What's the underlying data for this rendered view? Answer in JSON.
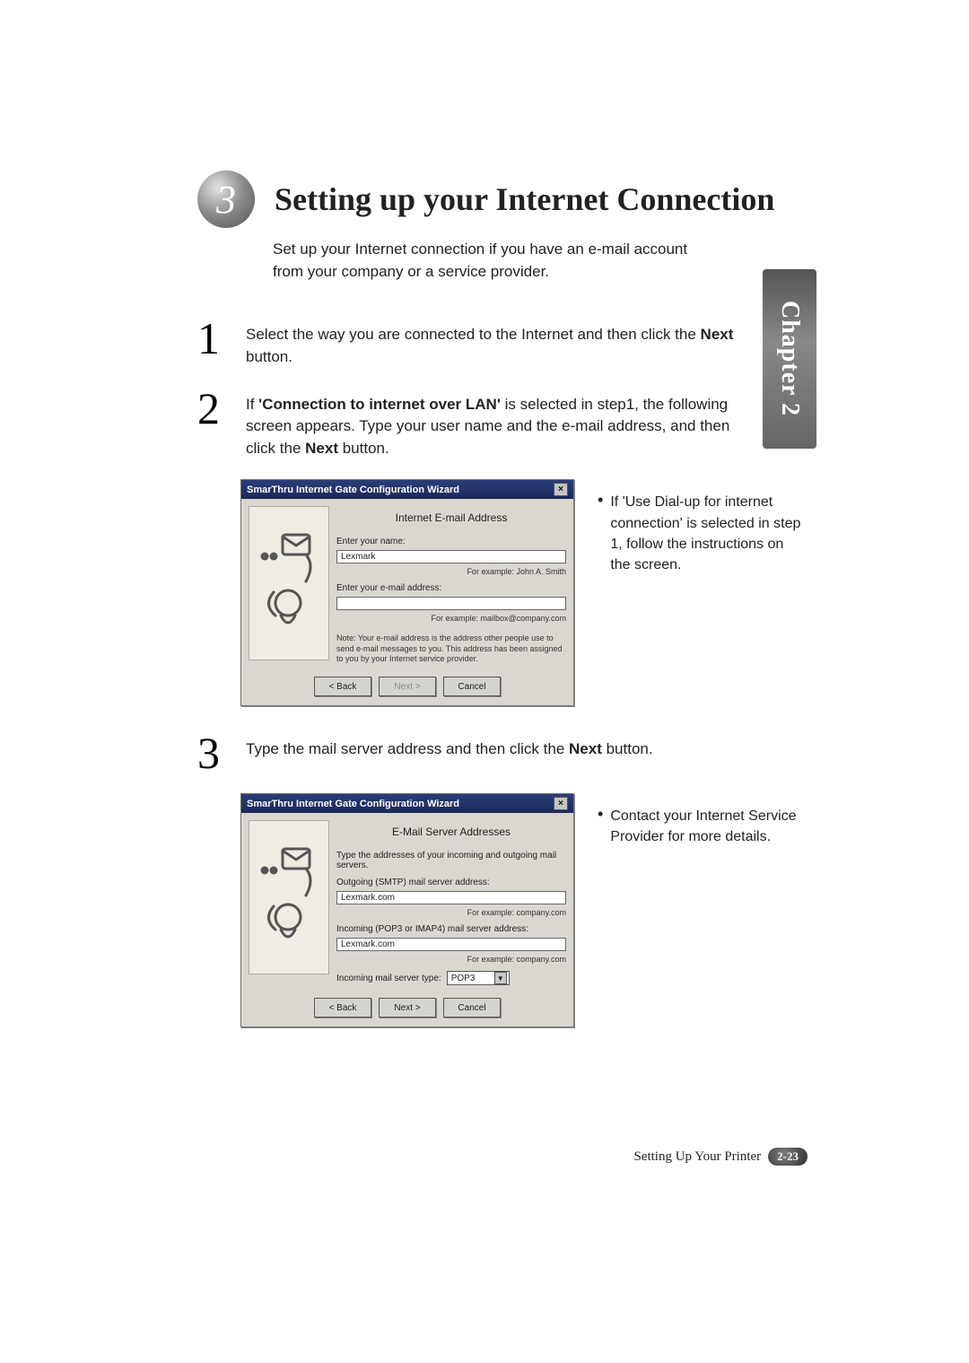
{
  "chapter_tab": "Chapter 2",
  "badge_number": "3",
  "title": "Setting up your Internet Connection",
  "intro": "Set up your Internet connection if you have an e-mail account from your company or a service provider.",
  "steps": {
    "s1": {
      "num": "1",
      "pre": "Select the way you are connected to the Internet and then click the ",
      "bold": "Next",
      "post": " button."
    },
    "s2": {
      "num": "2",
      "a": "If ",
      "b1": "'Connection to internet over LAN'",
      "c": " is selected in step1, the following screen appears. Type your user name and the e-mail address, and then click the ",
      "b2": "Next",
      "d": " button."
    },
    "s3": {
      "num": "3",
      "pre": "Type the mail server address and then click the ",
      "bold": "Next",
      "post": " button."
    }
  },
  "side1": "If 'Use Dial-up for internet connection' is selected in step 1, follow the instructions on the screen.",
  "side2": "Contact your Internet Service Provider for more details.",
  "dlg": {
    "title": "SmarThru Internet Gate Configuration Wizard",
    "close": "×",
    "back": "< Back",
    "next": "Next >",
    "cancel": "Cancel"
  },
  "dlg1": {
    "heading": "Internet E-mail Address",
    "lbl_name": "Enter your name:",
    "val_name": "Lexmark",
    "hint_name": "For example: John A. Smith",
    "lbl_email": "Enter your e-mail address:",
    "hint_email": "For example: mailbox@company.com",
    "note": "Note: Your e-mail address is the address other people use to send e-mail messages to you. This address has been assigned to you by your Internet service provider."
  },
  "dlg2": {
    "heading": "E-Mail Server Addresses",
    "intro": "Type the addresses of your incoming and outgoing  mail servers.",
    "lbl_out": "Outgoing (SMTP) mail server address:",
    "val_out": "Lexmark.com",
    "hint_out": "For example: company.com",
    "lbl_in": "Incoming (POP3 or IMAP4) mail server address:",
    "val_in": "Lexmark.com",
    "hint_in": "For example: company.com",
    "lbl_type": "Incoming mail server type:",
    "val_type": "POP3"
  },
  "footer": {
    "label": "Setting Up Your Printer",
    "page": "2-23"
  }
}
